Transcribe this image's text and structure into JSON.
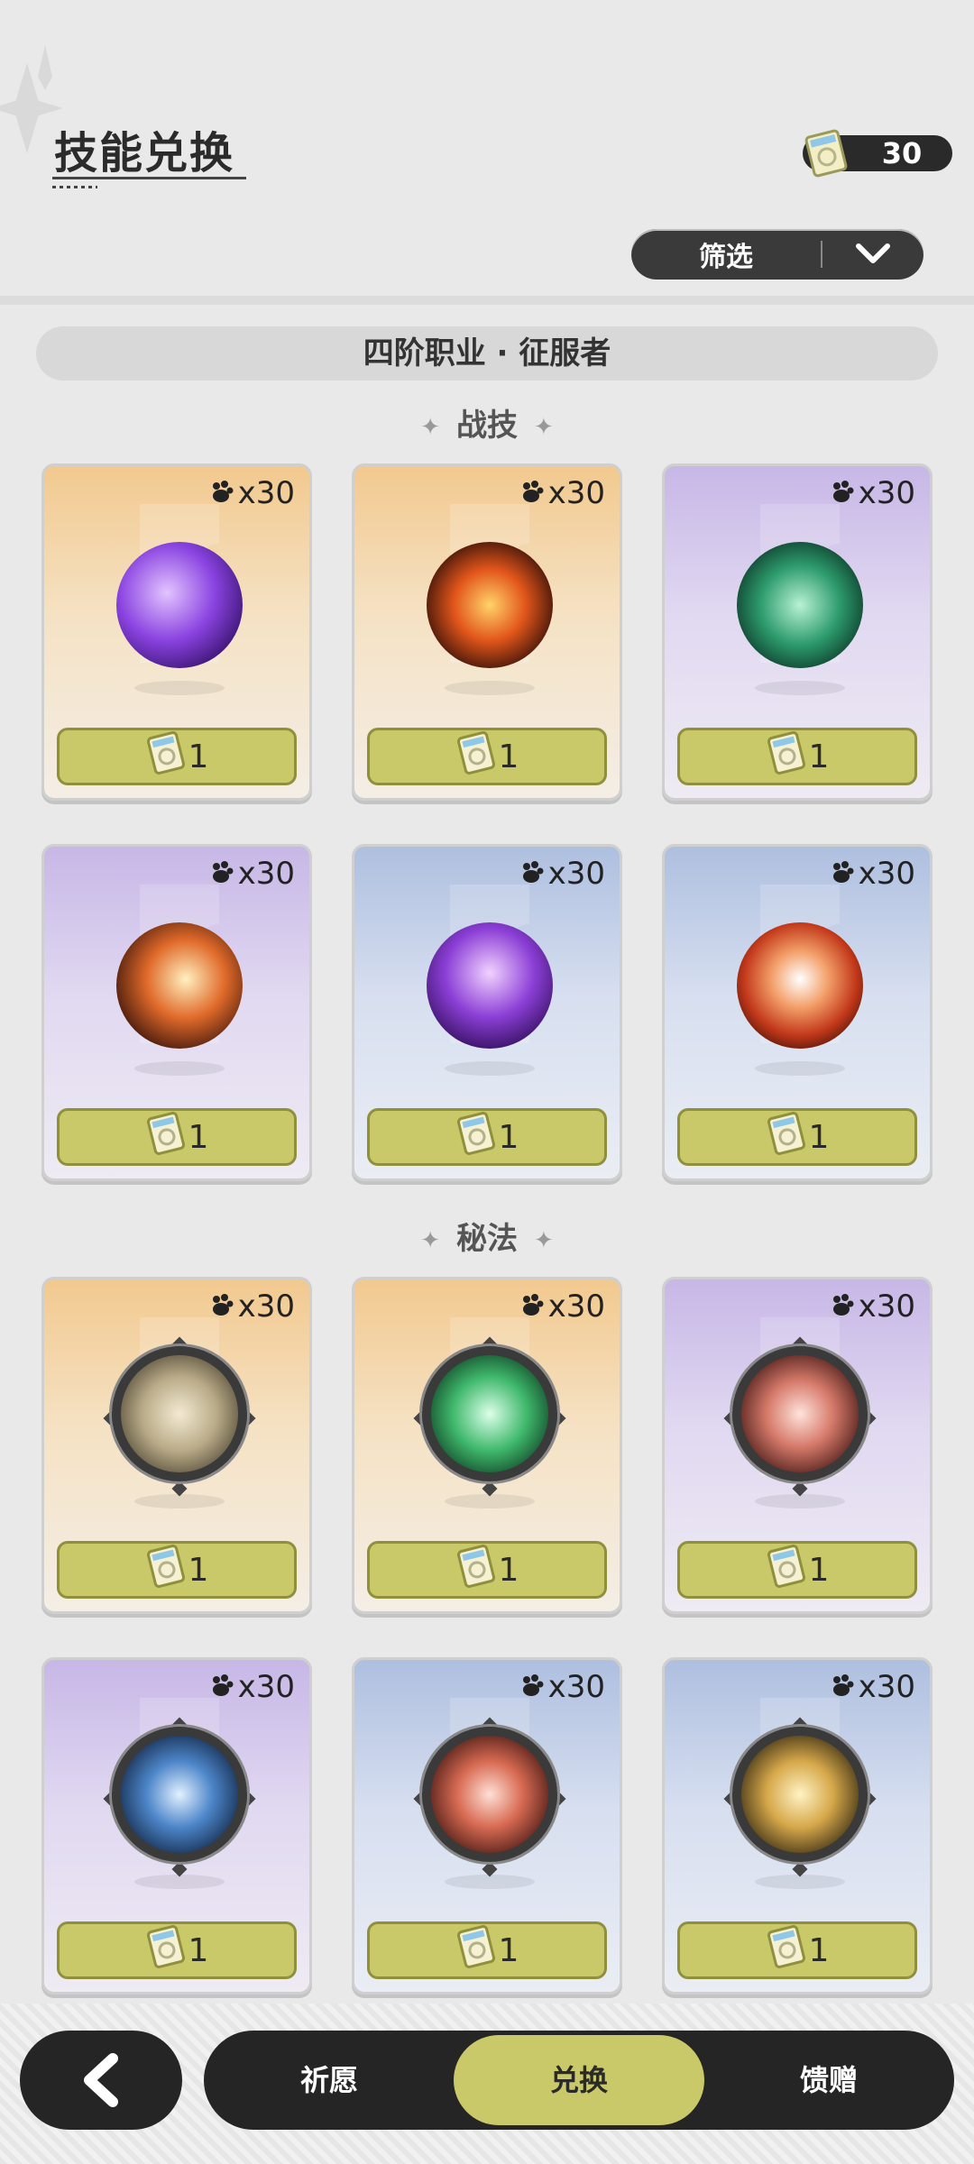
{
  "header": {
    "title": "技能兑换",
    "currency_value": "30",
    "currency_icon": "ticket-icon",
    "filter_label": "筛选"
  },
  "class_label": "四阶职业 · 征服者",
  "sections": [
    {
      "title": "战技",
      "cards": [
        {
          "cost": "x30",
          "price": "1",
          "rarity": "gold",
          "skill_icon": "purple-rose-skill-icon"
        },
        {
          "cost": "x30",
          "price": "1",
          "rarity": "gold",
          "skill_icon": "fire-swirl-skill-icon"
        },
        {
          "cost": "x30",
          "price": "1",
          "rarity": "purple",
          "skill_icon": "green-ring-skill-icon"
        },
        {
          "cost": "x30",
          "price": "1",
          "rarity": "purple",
          "skill_icon": "flame-slash-skill-icon"
        },
        {
          "cost": "x30",
          "price": "1",
          "rarity": "blue",
          "skill_icon": "ghost-skill-icon"
        },
        {
          "cost": "x30",
          "price": "1",
          "rarity": "blue",
          "skill_icon": "fire-figure-skill-icon"
        }
      ]
    },
    {
      "title": "秘法",
      "cards": [
        {
          "cost": "x30",
          "price": "1",
          "rarity": "gold",
          "skill_icon": "shield-figure-rune-icon"
        },
        {
          "cost": "x30",
          "price": "1",
          "rarity": "gold",
          "skill_icon": "green-crystal-rune-icon"
        },
        {
          "cost": "x30",
          "price": "1",
          "rarity": "purple",
          "skill_icon": "red-slash-rune-icon"
        },
        {
          "cost": "x30",
          "price": "1",
          "rarity": "purple",
          "skill_icon": "blue-crown-rune-icon"
        },
        {
          "cost": "x30",
          "price": "1",
          "rarity": "blue",
          "skill_icon": "red-flower-rune-icon"
        },
        {
          "cost": "x30",
          "price": "1",
          "rarity": "blue",
          "skill_icon": "golden-figure-rune-icon"
        }
      ]
    }
  ],
  "bottom_nav": {
    "back_icon": "back-arrow-icon",
    "tabs": [
      {
        "label": "祈愿"
      },
      {
        "label": "兑换",
        "active": true
      },
      {
        "label": "馈赠"
      }
    ]
  },
  "colors": {
    "buy_button": "#c9c96a",
    "nav_bg": "#252525",
    "gold_card": "#f2c98f",
    "purple_card": "#c7b7e6",
    "blue_card": "#aebfdf"
  }
}
